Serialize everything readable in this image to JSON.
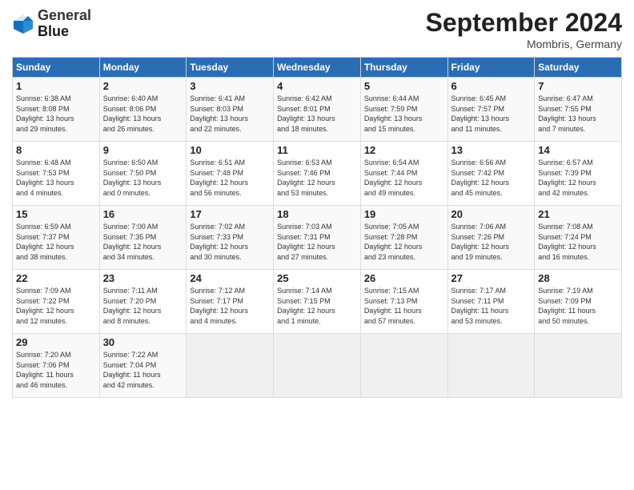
{
  "header": {
    "logo_line1": "General",
    "logo_line2": "Blue",
    "month_title": "September 2024",
    "subtitle": "Mombris, Germany"
  },
  "weekdays": [
    "Sunday",
    "Monday",
    "Tuesday",
    "Wednesday",
    "Thursday",
    "Friday",
    "Saturday"
  ],
  "weeks": [
    [
      {
        "day": "1",
        "info": "Sunrise: 6:38 AM\nSunset: 8:08 PM\nDaylight: 13 hours\nand 29 minutes."
      },
      {
        "day": "2",
        "info": "Sunrise: 6:40 AM\nSunset: 8:06 PM\nDaylight: 13 hours\nand 26 minutes."
      },
      {
        "day": "3",
        "info": "Sunrise: 6:41 AM\nSunset: 8:03 PM\nDaylight: 13 hours\nand 22 minutes."
      },
      {
        "day": "4",
        "info": "Sunrise: 6:42 AM\nSunset: 8:01 PM\nDaylight: 13 hours\nand 18 minutes."
      },
      {
        "day": "5",
        "info": "Sunrise: 6:44 AM\nSunset: 7:59 PM\nDaylight: 13 hours\nand 15 minutes."
      },
      {
        "day": "6",
        "info": "Sunrise: 6:45 AM\nSunset: 7:57 PM\nDaylight: 13 hours\nand 11 minutes."
      },
      {
        "day": "7",
        "info": "Sunrise: 6:47 AM\nSunset: 7:55 PM\nDaylight: 13 hours\nand 7 minutes."
      }
    ],
    [
      {
        "day": "8",
        "info": "Sunrise: 6:48 AM\nSunset: 7:53 PM\nDaylight: 13 hours\nand 4 minutes."
      },
      {
        "day": "9",
        "info": "Sunrise: 6:50 AM\nSunset: 7:50 PM\nDaylight: 13 hours\nand 0 minutes."
      },
      {
        "day": "10",
        "info": "Sunrise: 6:51 AM\nSunset: 7:48 PM\nDaylight: 12 hours\nand 56 minutes."
      },
      {
        "day": "11",
        "info": "Sunrise: 6:53 AM\nSunset: 7:46 PM\nDaylight: 12 hours\nand 53 minutes."
      },
      {
        "day": "12",
        "info": "Sunrise: 6:54 AM\nSunset: 7:44 PM\nDaylight: 12 hours\nand 49 minutes."
      },
      {
        "day": "13",
        "info": "Sunrise: 6:56 AM\nSunset: 7:42 PM\nDaylight: 12 hours\nand 45 minutes."
      },
      {
        "day": "14",
        "info": "Sunrise: 6:57 AM\nSunset: 7:39 PM\nDaylight: 12 hours\nand 42 minutes."
      }
    ],
    [
      {
        "day": "15",
        "info": "Sunrise: 6:59 AM\nSunset: 7:37 PM\nDaylight: 12 hours\nand 38 minutes."
      },
      {
        "day": "16",
        "info": "Sunrise: 7:00 AM\nSunset: 7:35 PM\nDaylight: 12 hours\nand 34 minutes."
      },
      {
        "day": "17",
        "info": "Sunrise: 7:02 AM\nSunset: 7:33 PM\nDaylight: 12 hours\nand 30 minutes."
      },
      {
        "day": "18",
        "info": "Sunrise: 7:03 AM\nSunset: 7:31 PM\nDaylight: 12 hours\nand 27 minutes."
      },
      {
        "day": "19",
        "info": "Sunrise: 7:05 AM\nSunset: 7:28 PM\nDaylight: 12 hours\nand 23 minutes."
      },
      {
        "day": "20",
        "info": "Sunrise: 7:06 AM\nSunset: 7:26 PM\nDaylight: 12 hours\nand 19 minutes."
      },
      {
        "day": "21",
        "info": "Sunrise: 7:08 AM\nSunset: 7:24 PM\nDaylight: 12 hours\nand 16 minutes."
      }
    ],
    [
      {
        "day": "22",
        "info": "Sunrise: 7:09 AM\nSunset: 7:22 PM\nDaylight: 12 hours\nand 12 minutes."
      },
      {
        "day": "23",
        "info": "Sunrise: 7:11 AM\nSunset: 7:20 PM\nDaylight: 12 hours\nand 8 minutes."
      },
      {
        "day": "24",
        "info": "Sunrise: 7:12 AM\nSunset: 7:17 PM\nDaylight: 12 hours\nand 4 minutes."
      },
      {
        "day": "25",
        "info": "Sunrise: 7:14 AM\nSunset: 7:15 PM\nDaylight: 12 hours\nand 1 minute."
      },
      {
        "day": "26",
        "info": "Sunrise: 7:15 AM\nSunset: 7:13 PM\nDaylight: 11 hours\nand 57 minutes."
      },
      {
        "day": "27",
        "info": "Sunrise: 7:17 AM\nSunset: 7:11 PM\nDaylight: 11 hours\nand 53 minutes."
      },
      {
        "day": "28",
        "info": "Sunrise: 7:19 AM\nSunset: 7:09 PM\nDaylight: 11 hours\nand 50 minutes."
      }
    ],
    [
      {
        "day": "29",
        "info": "Sunrise: 7:20 AM\nSunset: 7:06 PM\nDaylight: 11 hours\nand 46 minutes."
      },
      {
        "day": "30",
        "info": "Sunrise: 7:22 AM\nSunset: 7:04 PM\nDaylight: 11 hours\nand 42 minutes."
      },
      null,
      null,
      null,
      null,
      null
    ]
  ]
}
